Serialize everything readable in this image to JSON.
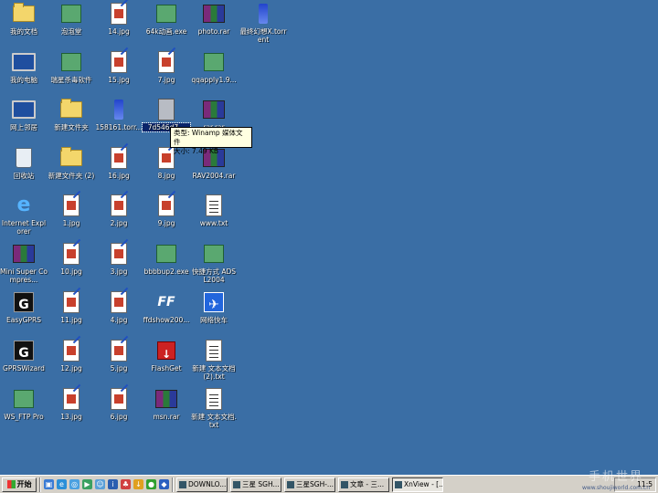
{
  "desktop": {
    "icons": [
      {
        "label": "我的文档",
        "glyph": "folder"
      },
      {
        "label": "我的电脑",
        "glyph": "monitor"
      },
      {
        "label": "网上邻居",
        "glyph": "monitor"
      },
      {
        "label": "回收站",
        "glyph": "recycle"
      },
      {
        "label": "Internet Explorer",
        "glyph": "ie",
        "char": "e"
      },
      {
        "label": "Mini Super Compres...",
        "glyph": "rar"
      },
      {
        "label": "EasyGPRS",
        "glyph": "black",
        "char": "G"
      },
      {
        "label": "GPRSWizard",
        "glyph": "black",
        "char": "G"
      },
      {
        "label": "WS_FTP Pro",
        "glyph": "exe"
      },
      {
        "label": "泡泡堂",
        "glyph": "exe"
      },
      {
        "label": "瑞星杀毒软件",
        "glyph": "exe"
      },
      {
        "label": "新建文件夹",
        "glyph": "folder"
      },
      {
        "label": "新建文件夹 (2)",
        "glyph": "folder"
      },
      {
        "label": "1.jpg",
        "glyph": "doc"
      },
      {
        "label": "10.jpg",
        "glyph": "doc"
      },
      {
        "label": "11.jpg",
        "glyph": "doc"
      },
      {
        "label": "12.jpg",
        "glyph": "doc"
      },
      {
        "label": "13.jpg",
        "glyph": "doc"
      },
      {
        "label": "14.jpg",
        "glyph": "doc"
      },
      {
        "label": "15.jpg",
        "glyph": "doc"
      },
      {
        "label": "158161.torr...",
        "glyph": "torrent"
      },
      {
        "label": "16.jpg",
        "glyph": "doc"
      },
      {
        "label": "2.jpg",
        "glyph": "doc"
      },
      {
        "label": "3.jpg",
        "glyph": "doc"
      },
      {
        "label": "4.jpg",
        "glyph": "doc"
      },
      {
        "label": "5.jpg",
        "glyph": "doc"
      },
      {
        "label": "6.jpg",
        "glyph": "doc"
      },
      {
        "label": "64k动画.exe",
        "glyph": "exe"
      },
      {
        "label": "7.jpg",
        "glyph": "doc"
      },
      {
        "label": "7d546d7...",
        "glyph": "generic",
        "selected": true
      },
      {
        "label": "8.jpg",
        "glyph": "doc"
      },
      {
        "label": "9.jpg",
        "glyph": "doc"
      },
      {
        "label": "bbbbup2.exe",
        "glyph": "exe"
      },
      {
        "label": "ffdshow200...",
        "glyph": "ff",
        "char": "FF"
      },
      {
        "label": "FlashGet",
        "glyph": "red",
        "char": "↓"
      },
      {
        "label": "msn.rar",
        "glyph": "rar"
      },
      {
        "label": "photo.rar",
        "glyph": "rar"
      },
      {
        "label": "qqapply1.9...",
        "glyph": "exe"
      },
      {
        "label": "rar.rar",
        "glyph": "rar"
      },
      {
        "label": "RAV2004.rar",
        "glyph": "rar"
      },
      {
        "label": "www.txt",
        "glyph": "txt"
      },
      {
        "label": "快捷方式 ADSL2004",
        "glyph": "exe"
      },
      {
        "label": "网络快车",
        "glyph": "blue",
        "char": "✈"
      },
      {
        "label": "新建 文本文档 (2).txt",
        "glyph": "txt"
      },
      {
        "label": "新建 文本文档.txt",
        "glyph": "txt"
      },
      {
        "label": "最终幻想X.torrent",
        "glyph": "torrent"
      }
    ]
  },
  "tooltip": {
    "line1": "类型: Winamp 媒体文件",
    "line2": "大小: 7.49 KB"
  },
  "taskbar": {
    "start_label": "开始",
    "tasks": [
      {
        "label": "DOWNLO..."
      },
      {
        "label": "三星 SGH..."
      },
      {
        "label": "三星SGH-..."
      },
      {
        "label": "文章 - 三..."
      },
      {
        "label": "XnView - [...",
        "active": true
      }
    ],
    "clock": "11:5"
  },
  "watermark": {
    "text": "手机世界",
    "url": "www.shoujiworld.com.cn"
  }
}
